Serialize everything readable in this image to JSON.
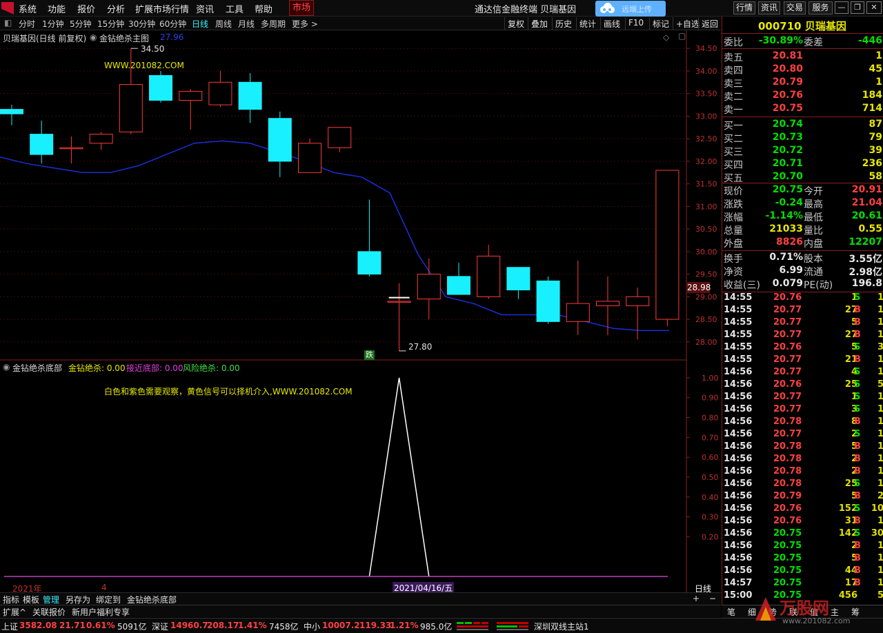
{
  "titlebar": {
    "menus": [
      "系统",
      "功能",
      "报价",
      "分析",
      "扩展市场行情",
      "资讯",
      "工具",
      "帮助"
    ],
    "market": "市场",
    "app_title": "通达信金融终端  贝瑞基因",
    "cloud_label": "远端上传",
    "right_buttons": [
      "行情",
      "资讯",
      "交易",
      "服务"
    ]
  },
  "toolbar": {
    "periods": [
      "分时",
      "1分钟",
      "5分钟",
      "15分钟",
      "30分钟",
      "60分钟",
      "日线",
      "周线",
      "月线",
      "多周期",
      "更多 >"
    ],
    "active": "日线",
    "right": [
      "复权",
      "叠加",
      "历史",
      "统计",
      "画线",
      "F10",
      "标记",
      "+自选",
      "返回"
    ]
  },
  "main_panel": {
    "title": "贝瑞基因(日线 前复权)",
    "indicator": "金钻绝杀主图",
    "indicator_value": "27.96",
    "watermark": "WWW.201082.COM",
    "high_label": "34.50",
    "low_label": "27.80",
    "fall_badge": "跌",
    "price_tag": "28.98",
    "yticks": [
      "34.50",
      "34.00",
      "33.50",
      "33.00",
      "32.50",
      "32.00",
      "31.50",
      "31.00",
      "30.50",
      "30.00",
      "29.50",
      "29.00",
      "28.50",
      "28.00"
    ]
  },
  "sub_panel": {
    "title": "金钻绝杀底部",
    "v1_label": "金钻绝杀: 0.00",
    "v2_label": "接近底部: 0.00",
    "v3_label": "风险绝杀: 0.00",
    "note": "白色和紫色需要观察，黄色信号可以择机介入,WWW.201082.COM",
    "yticks": [
      "1.00",
      "0.90",
      "0.80",
      "0.70",
      "0.60",
      "0.50",
      "0.40",
      "0.30",
      "0.20"
    ]
  },
  "xaxis": {
    "year": "2021年",
    "month": "4",
    "cursor_date": "2021/04/16/五",
    "period_label": "日线"
  },
  "chart_data": {
    "type": "candlestick",
    "ylim": [
      27.6,
      34.9
    ],
    "candles": [
      {
        "o": 33.15,
        "h": 33.25,
        "l": 32.8,
        "c": 33.05
      },
      {
        "o": 32.6,
        "h": 32.9,
        "l": 31.95,
        "c": 32.15
      },
      {
        "o": 32.3,
        "h": 32.55,
        "l": 31.95,
        "c": 32.3
      },
      {
        "o": 32.4,
        "h": 32.65,
        "l": 32.25,
        "c": 32.6
      },
      {
        "o": 32.65,
        "h": 34.5,
        "l": 32.6,
        "c": 33.7
      },
      {
        "o": 33.9,
        "h": 34.0,
        "l": 33.3,
        "c": 33.35
      },
      {
        "o": 33.35,
        "h": 33.6,
        "l": 32.7,
        "c": 33.55
      },
      {
        "o": 33.25,
        "h": 34.0,
        "l": 33.2,
        "c": 33.75
      },
      {
        "o": 33.75,
        "h": 33.95,
        "l": 32.85,
        "c": 33.15
      },
      {
        "o": 32.95,
        "h": 33.1,
        "l": 31.65,
        "c": 32.0
      },
      {
        "o": 31.75,
        "h": 32.5,
        "l": 31.75,
        "c": 32.4
      },
      {
        "o": 32.3,
        "h": 32.75,
        "l": 32.2,
        "c": 32.75
      },
      {
        "o": 30.0,
        "h": 31.15,
        "l": 29.45,
        "c": 29.5
      },
      {
        "o": 28.9,
        "h": 29.3,
        "l": 27.8,
        "c": 28.9
      },
      {
        "o": 28.95,
        "h": 29.85,
        "l": 28.5,
        "c": 29.5
      },
      {
        "o": 29.45,
        "h": 29.75,
        "l": 29.05,
        "c": 29.05
      },
      {
        "o": 29.0,
        "h": 30.15,
        "l": 28.95,
        "c": 29.9
      },
      {
        "o": 29.65,
        "h": 29.65,
        "l": 28.95,
        "c": 29.15
      },
      {
        "o": 29.35,
        "h": 29.45,
        "l": 28.4,
        "c": 28.45
      },
      {
        "o": 28.45,
        "h": 29.8,
        "l": 28.15,
        "c": 28.85
      },
      {
        "o": 28.8,
        "h": 29.45,
        "l": 28.15,
        "c": 28.9
      },
      {
        "o": 28.8,
        "h": 29.2,
        "l": 28.05,
        "c": 29.0
      },
      {
        "o": 28.5,
        "h": 31.8,
        "l": 28.35,
        "c": 31.8
      }
    ],
    "ma": [
      32.1,
      31.95,
      31.85,
      31.75,
      31.75,
      31.9,
      32.15,
      32.4,
      32.45,
      32.4,
      32.2,
      32.0,
      31.75,
      31.65,
      31.3,
      29.95,
      29.0,
      28.85,
      28.6,
      28.6,
      28.6,
      28.45,
      28.3,
      28.25,
      28.25
    ],
    "signal": {
      "ylim": [
        0,
        1.05
      ],
      "values": [
        0,
        0,
        0,
        0,
        0,
        0,
        0,
        0,
        0,
        0,
        0,
        0,
        0,
        1,
        0,
        0,
        0,
        0,
        0,
        0,
        0,
        0,
        0
      ]
    }
  },
  "quote": {
    "code_name": "000710 贝瑞基因",
    "weibi_label": "委比",
    "weibi": "-30.89%",
    "weicha_label": "委差",
    "weicha": "-446",
    "sell": [
      {
        "label": "卖五",
        "price": "20.81",
        "vol": "1"
      },
      {
        "label": "卖四",
        "price": "20.80",
        "vol": "45"
      },
      {
        "label": "卖三",
        "price": "20.79",
        "vol": "1"
      },
      {
        "label": "卖二",
        "price": "20.76",
        "vol": "184"
      },
      {
        "label": "卖一",
        "price": "20.75",
        "vol": "714"
      }
    ],
    "buy": [
      {
        "label": "买一",
        "price": "20.74",
        "vol": "87"
      },
      {
        "label": "买二",
        "price": "20.73",
        "vol": "79"
      },
      {
        "label": "买三",
        "price": "20.72",
        "vol": "39"
      },
      {
        "label": "买四",
        "price": "20.71",
        "vol": "236"
      },
      {
        "label": "买五",
        "price": "20.70",
        "vol": "58"
      }
    ],
    "stats1": [
      {
        "l": "现价",
        "v": "20.75",
        "l2": "今开",
        "v2": "20.91"
      },
      {
        "l": "涨跌",
        "v": "-0.24",
        "l2": "最高",
        "v2": "21.04"
      },
      {
        "l": "涨幅",
        "v": "-1.14%",
        "l2": "最低",
        "v2": "20.61"
      },
      {
        "l": "总量",
        "v": "21033",
        "l2": "量比",
        "v2": "0.55"
      },
      {
        "l": "外盘",
        "v": "8826",
        "l2": "内盘",
        "v2": "12207"
      }
    ],
    "stats2": [
      {
        "l": "换手",
        "v": "0.71%",
        "l2": "股本",
        "v2": "3.55亿"
      },
      {
        "l": "净资",
        "v": "6.99",
        "l2": "流通",
        "v2": "2.98亿"
      },
      {
        "l": "收益(三)",
        "v": "0.079",
        "l2": "PE(动)",
        "v2": "196.8"
      }
    ],
    "ticks": [
      {
        "t": "14:55",
        "p": "20.76",
        "q": "1",
        "s": "S",
        "n": "1"
      },
      {
        "t": "14:55",
        "p": "20.77",
        "q": "27",
        "s": "B",
        "n": "1"
      },
      {
        "t": "14:55",
        "p": "20.77",
        "q": "5",
        "s": "B",
        "n": "1"
      },
      {
        "t": "14:55",
        "p": "20.77",
        "q": "27",
        "s": "B",
        "n": "1"
      },
      {
        "t": "14:55",
        "p": "20.76",
        "q": "5",
        "s": "S",
        "n": "3"
      },
      {
        "t": "14:55",
        "p": "20.77",
        "q": "21",
        "s": "B",
        "n": "1"
      },
      {
        "t": "14:56",
        "p": "20.77",
        "q": "4",
        "s": "S",
        "n": "1"
      },
      {
        "t": "14:56",
        "p": "20.76",
        "q": "25",
        "s": "S",
        "n": "5"
      },
      {
        "t": "14:56",
        "p": "20.77",
        "q": "1",
        "s": "S",
        "n": "1"
      },
      {
        "t": "14:56",
        "p": "20.77",
        "q": "3",
        "s": "S",
        "n": "1"
      },
      {
        "t": "14:56",
        "p": "20.78",
        "q": "8",
        "s": "B",
        "n": "1"
      },
      {
        "t": "14:56",
        "p": "20.77",
        "q": "2",
        "s": "S",
        "n": "1"
      },
      {
        "t": "14:56",
        "p": "20.78",
        "q": "5",
        "s": "B",
        "n": "1"
      },
      {
        "t": "14:56",
        "p": "20.78",
        "q": "2",
        "s": "B",
        "n": "1"
      },
      {
        "t": "14:56",
        "p": "20.78",
        "q": "2",
        "s": "B",
        "n": "1"
      },
      {
        "t": "14:56",
        "p": "20.78",
        "q": "25",
        "s": "S",
        "n": "1"
      },
      {
        "t": "14:56",
        "p": "20.79",
        "q": "5",
        "s": "B",
        "n": "2"
      },
      {
        "t": "14:56",
        "p": "20.76",
        "q": "152",
        "s": "S",
        "n": "10"
      },
      {
        "t": "14:56",
        "p": "20.76",
        "q": "31",
        "s": "B",
        "n": "1"
      },
      {
        "t": "14:56",
        "p": "20.75",
        "q": "142",
        "s": "S",
        "n": "30"
      },
      {
        "t": "14:56",
        "p": "20.75",
        "q": "2",
        "s": "B",
        "n": "1"
      },
      {
        "t": "14:56",
        "p": "20.75",
        "q": "5",
        "s": "B",
        "n": "1"
      },
      {
        "t": "14:56",
        "p": "20.75",
        "q": "44",
        "s": "B",
        "n": "1"
      },
      {
        "t": "14:57",
        "p": "20.75",
        "q": "17",
        "s": "B",
        "n": "1"
      },
      {
        "t": "15:00",
        "p": "20.75",
        "q": "456",
        "s": "",
        "n": "5"
      }
    ],
    "tabs": [
      "笔",
      "细",
      "势",
      "联",
      "值",
      "主",
      "筹"
    ]
  },
  "bottom": {
    "tabs1": [
      "指标",
      "模板",
      "管理",
      "另存为",
      "绑定到",
      "金钻绝杀底部"
    ],
    "tabs2": [
      "扩展^",
      "关联报价",
      "新用户福利专享"
    ],
    "status": [
      {
        "name": "上证",
        "v1": "3582.08",
        "v2": "21.71",
        "v3": "0.61%",
        "v4": "5091亿"
      },
      {
        "name": "深证",
        "v1": "14960.7",
        "v2": "208.17",
        "v3": "1.41%",
        "v4": "7458亿"
      },
      {
        "name": "中小",
        "v1": "10007.2",
        "v2": "119.33",
        "v3": "1.21%",
        "v4": "985.0亿"
      }
    ],
    "server": "深圳双线主站1",
    "brand": "万股网",
    "brand_url": "www.201082.com"
  }
}
